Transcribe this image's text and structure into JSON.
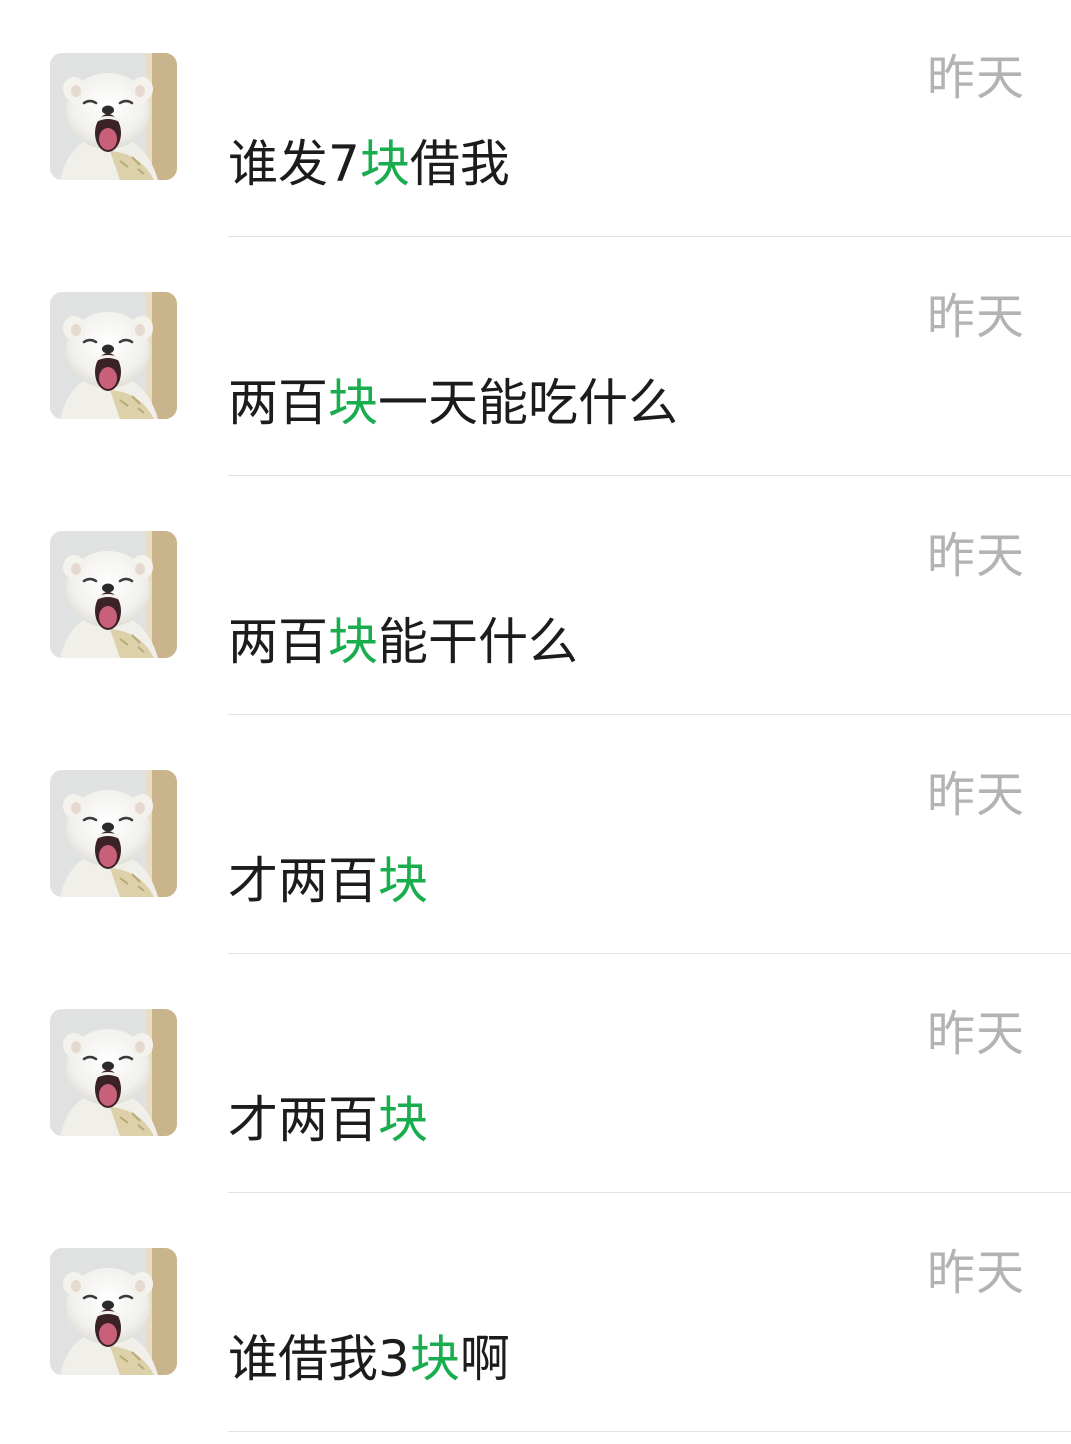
{
  "chats": [
    {
      "time": "昨天",
      "parts": [
        {
          "text": "谁发7",
          "hl": false
        },
        {
          "text": "块",
          "hl": true
        },
        {
          "text": "借我",
          "hl": false
        }
      ]
    },
    {
      "time": "昨天",
      "parts": [
        {
          "text": "两百",
          "hl": false
        },
        {
          "text": "块",
          "hl": true
        },
        {
          "text": "一天能吃什么",
          "hl": false
        }
      ]
    },
    {
      "time": "昨天",
      "parts": [
        {
          "text": "两百",
          "hl": false
        },
        {
          "text": "块",
          "hl": true
        },
        {
          "text": "能干什么",
          "hl": false
        }
      ]
    },
    {
      "time": "昨天",
      "parts": [
        {
          "text": "才两百",
          "hl": false
        },
        {
          "text": "块",
          "hl": true
        }
      ]
    },
    {
      "time": "昨天",
      "parts": [
        {
          "text": "才两百",
          "hl": false
        },
        {
          "text": "块",
          "hl": true
        }
      ]
    },
    {
      "time": "昨天",
      "parts": [
        {
          "text": "谁借我3",
          "hl": false
        },
        {
          "text": "块",
          "hl": true
        },
        {
          "text": "啊",
          "hl": false
        }
      ]
    }
  ],
  "avatar_icon": "white-puppy-yawning-avatar",
  "colors": {
    "highlight": "#1aad4e",
    "time": "#b3b3b3",
    "text": "#1c1c1c",
    "divider": "#e2e2e2"
  }
}
